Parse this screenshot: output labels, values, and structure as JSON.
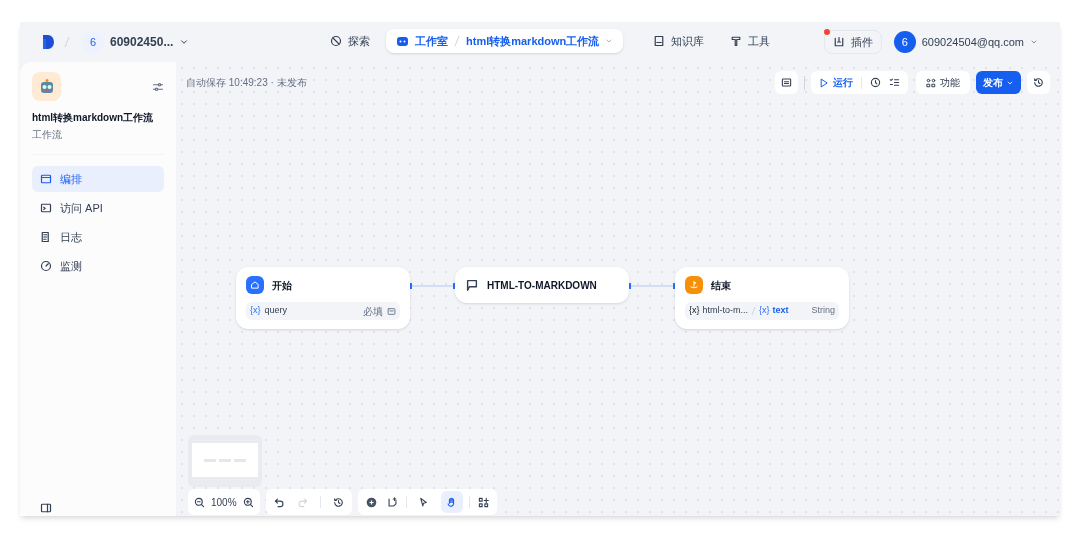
{
  "header": {
    "account": {
      "avatar": "6",
      "name": "60902450..."
    },
    "nav": [
      {
        "kind": "link",
        "label": "探索",
        "selected": false
      },
      {
        "kind": "breadcrumb",
        "label": "工作室",
        "current": "html转换markdown工作流",
        "selected": true
      },
      {
        "kind": "link",
        "label": "知识库",
        "selected": false
      },
      {
        "kind": "link",
        "label": "工具",
        "selected": false
      }
    ],
    "plugin": {
      "label": "插件",
      "notification": true
    },
    "user": {
      "avatar": "6",
      "email": "609024504@qq.com"
    }
  },
  "sidebar": {
    "title": "html转换markdown工作流",
    "subtitle": "工作流",
    "items": [
      {
        "label": "编排",
        "selected": true
      },
      {
        "label": "访问 API",
        "selected": false
      },
      {
        "label": "日志",
        "selected": false
      },
      {
        "label": "监测",
        "selected": false
      }
    ]
  },
  "canvas": {
    "autosave": "自动保存 10:49:23 · 未发布",
    "toolbar": {
      "run": "运行",
      "features": "功能",
      "publish": "发布"
    },
    "nodes": [
      {
        "kind": "start",
        "title": "开始",
        "params": [
          {
            "icon": "{x}",
            "name": "query",
            "required": "必填"
          }
        ]
      },
      {
        "kind": "answer",
        "title": "HTML-TO-MARKDOWN"
      },
      {
        "kind": "end",
        "title": "结束",
        "outputs": [
          {
            "source_icon": "{x}",
            "source": "html-to-m...",
            "variable_icon": "{x}",
            "variable": "text",
            "type": "String"
          }
        ]
      }
    ],
    "zoom": "100%",
    "modes": [
      {
        "kind": "pointer",
        "selected": false
      },
      {
        "kind": "hand",
        "selected": true
      }
    ]
  }
}
